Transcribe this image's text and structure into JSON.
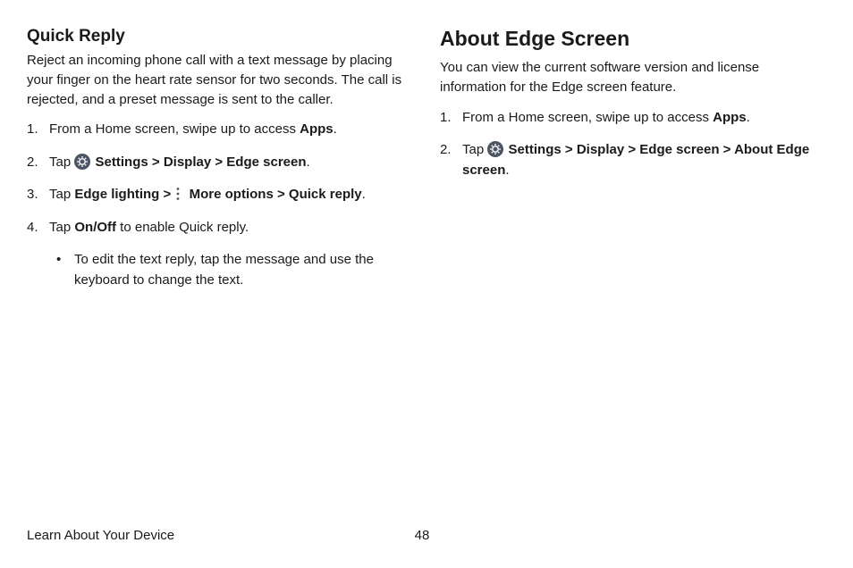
{
  "left": {
    "heading": "Quick Reply",
    "intro": "Reject an incoming phone call with a text message by placing your finger on the heart rate sensor for two seconds. The call is rejected, and a preset message is sent to the caller.",
    "steps": {
      "s1_pre": "From a Home screen, swipe up to access ",
      "s1_bold": "Apps",
      "s1_post": ".",
      "s2_pre": "Tap ",
      "s2_settings": "Settings",
      "s2_chev1": " > ",
      "s2_display": "Display",
      "s2_chev2": " > ",
      "s2_edge": "Edge screen",
      "s2_post": ".",
      "s3_pre": "Tap ",
      "s3_el": "Edge lighting",
      "s3_chev1": " > ",
      "s3_more": "More options",
      "s3_chev2": " > ",
      "s3_quick": "Quick reply",
      "s3_post": ".",
      "s4_pre": "Tap ",
      "s4_onoff": "On/Off",
      "s4_post": " to enable Quick reply.",
      "bullet": "To edit the text reply, tap the message and use the keyboard to change the text."
    }
  },
  "right": {
    "heading": "About Edge Screen",
    "intro": "You can view the current software version and license information for the Edge screen feature.",
    "steps": {
      "s1_pre": "From a Home screen, swipe up to access ",
      "s1_bold": "Apps",
      "s1_post": ".",
      "s2_pre": "Tap ",
      "s2_settings": "Settings",
      "s2_chev1": " > ",
      "s2_display": "Display",
      "s2_chev2": " > ",
      "s2_edge": "Edge screen",
      "s2_chev3": " > ",
      "s2_about": "About Edge screen",
      "s2_post": "."
    }
  },
  "footer": {
    "title": "Learn About Your Device",
    "page": "48"
  }
}
